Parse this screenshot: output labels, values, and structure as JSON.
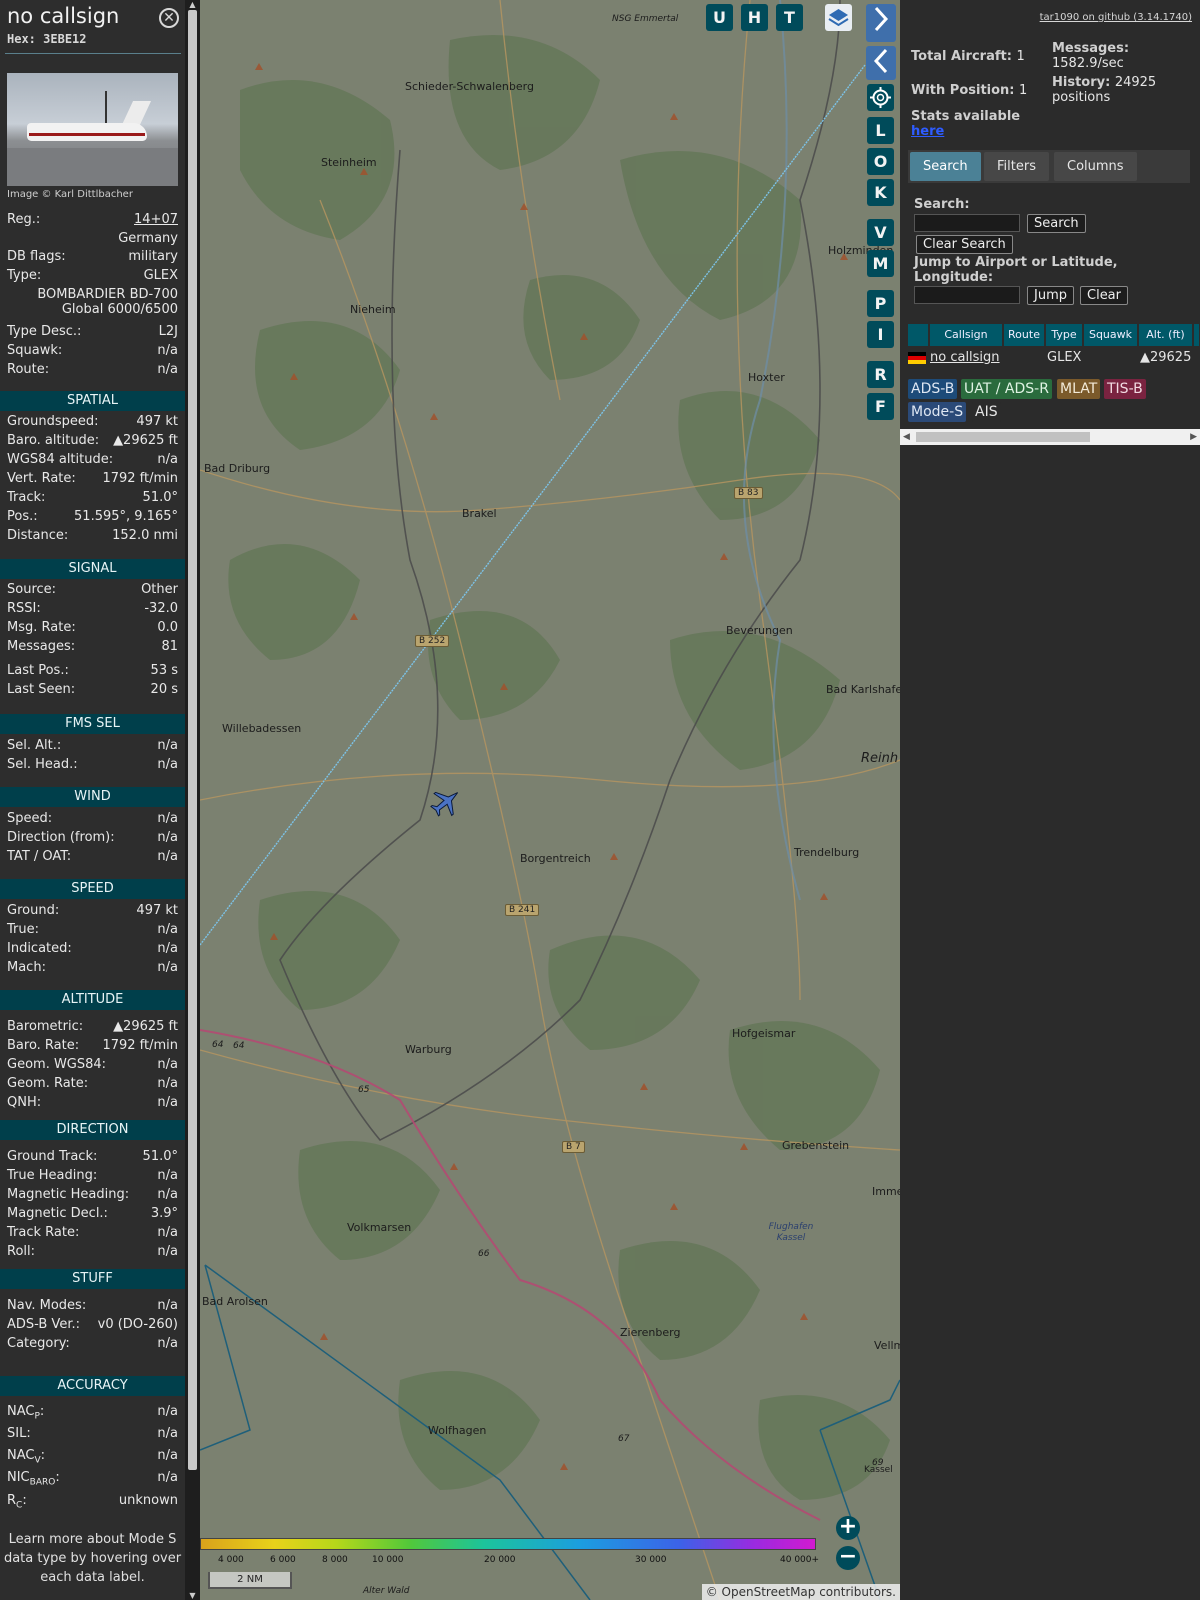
{
  "details": {
    "callsign": "no callsign",
    "hex_label": "Hex:",
    "hex": "3EBE12",
    "image_credit": "Image © Karl Dittlbacher",
    "reg_label": "Reg.:",
    "reg": "14+07",
    "country": "Germany",
    "dbflags_label": "DB flags:",
    "dbflags": "military",
    "type_label": "Type:",
    "type": "GLEX",
    "type_full": "BOMBARDIER BD-700 Global 6000/6500",
    "type_desc_label": "Type Desc.:",
    "type_desc": "L2J",
    "squawk_label": "Squawk:",
    "squawk": "n/a",
    "route_label": "Route:",
    "route": "n/a"
  },
  "spatial": {
    "title": "SPATIAL",
    "rows": [
      {
        "k": "Groundspeed:",
        "v": "497 kt"
      },
      {
        "k": "Baro. altitude:",
        "v": "▲29625 ft"
      },
      {
        "k": "WGS84 altitude:",
        "v": "n/a"
      },
      {
        "k": "Vert. Rate:",
        "v": "1792 ft/min"
      },
      {
        "k": "Track:",
        "v": "51.0°"
      },
      {
        "k": "Pos.:",
        "v": "51.595°, 9.165°"
      },
      {
        "k": "Distance:",
        "v": "152.0 nmi"
      }
    ]
  },
  "signal": {
    "title": "SIGNAL",
    "rows": [
      {
        "k": "Source:",
        "v": "Other"
      },
      {
        "k": "RSSI:",
        "v": "-32.0"
      },
      {
        "k": "Msg. Rate:",
        "v": "0.0"
      },
      {
        "k": "Messages:",
        "v": "81"
      },
      {
        "k": "Last Pos.:",
        "v": "53 s"
      },
      {
        "k": "Last Seen:",
        "v": "20 s"
      }
    ]
  },
  "fms": {
    "title": "FMS SEL",
    "rows": [
      {
        "k": "Sel. Alt.:",
        "v": "n/a"
      },
      {
        "k": "Sel. Head.:",
        "v": "n/a"
      }
    ]
  },
  "wind": {
    "title": "WIND",
    "rows": [
      {
        "k": "Speed:",
        "v": "n/a"
      },
      {
        "k": "Direction (from):",
        "v": "n/a"
      },
      {
        "k": "TAT / OAT:",
        "v": "n/a"
      }
    ]
  },
  "speed": {
    "title": "SPEED",
    "rows": [
      {
        "k": "Ground:",
        "v": "497 kt"
      },
      {
        "k": "True:",
        "v": "n/a"
      },
      {
        "k": "Indicated:",
        "v": "n/a"
      },
      {
        "k": "Mach:",
        "v": "n/a"
      }
    ]
  },
  "altitude": {
    "title": "ALTITUDE",
    "rows": [
      {
        "k": "Barometric:",
        "v": "▲29625 ft"
      },
      {
        "k": "Baro. Rate:",
        "v": "1792 ft/min"
      },
      {
        "k": "Geom. WGS84:",
        "v": "n/a"
      },
      {
        "k": "Geom. Rate:",
        "v": "n/a"
      },
      {
        "k": "QNH:",
        "v": "n/a"
      }
    ]
  },
  "direction": {
    "title": "DIRECTION",
    "rows": [
      {
        "k": "Ground Track:",
        "v": "51.0°"
      },
      {
        "k": "True Heading:",
        "v": "n/a"
      },
      {
        "k": "Magnetic Heading:",
        "v": "n/a"
      },
      {
        "k": "Magnetic Decl.:",
        "v": "3.9°"
      },
      {
        "k": "Track Rate:",
        "v": "n/a"
      },
      {
        "k": "Roll:",
        "v": "n/a"
      }
    ]
  },
  "stuff": {
    "title": "STUFF",
    "rows": [
      {
        "k": "Nav. Modes:",
        "v": "n/a"
      },
      {
        "k": "ADS-B Ver.:",
        "v": "v0 (DO-260)"
      },
      {
        "k": "Category:",
        "v": "n/a"
      }
    ]
  },
  "accuracy": {
    "title": "ACCURACY",
    "nacp_k": "NAC",
    "nacp_sub": "P",
    "nacp": "n/a",
    "sil_k": "SIL:",
    "sil": "n/a",
    "nacv_k": "NAC",
    "nacv_sub": "V",
    "nacv": "n/a",
    "nic_k": "NIC",
    "nic_sub": "BARO",
    "nic": "n/a",
    "rc_k": "R",
    "rc_sub": "C",
    "rc": "unknown"
  },
  "learn_more": "Learn more about Mode S data type by hovering over each data label.",
  "map": {
    "top_buttons": [
      "U",
      "H",
      "T"
    ],
    "side_buttons": [
      "L",
      "O",
      "K",
      "V",
      "M",
      "P",
      "I",
      "R",
      "F"
    ],
    "places": [
      "NSG Emmertal",
      "Schieder-Schwalenberg",
      "Steinheim",
      "Holzminden",
      "Nieheim",
      "Hoxter",
      "Bad Driburg",
      "Brakel",
      "Beverungen",
      "Bad Karlshafen",
      "Willebadessen",
      "Reinh",
      "Borgentreich",
      "Trendelburg",
      "Warburg",
      "Hofgeismar",
      "Grebenstein",
      "Imme",
      "Flughafen Kassel",
      "Volkmarsen",
      "Bad Arolsen",
      "Zierenberg",
      "Wolfhagen",
      "Vellm",
      "Kassel",
      "Alter Wald"
    ],
    "roads": [
      "B 83",
      "B 252",
      "B 241",
      "B 7"
    ],
    "road_numbers": [
      "64",
      "64",
      "65",
      "66",
      "67",
      "69"
    ],
    "altitude_scale": [
      "4 000",
      "6 000",
      "8 000",
      "10 000",
      "20 000",
      "30 000",
      "40 000+"
    ],
    "scale_label": "2 NM",
    "attribution": "© OpenStreetMap contributors."
  },
  "right": {
    "github": "tar1090 on github (3.14.1740)",
    "total_aircraft_label": "Total Aircraft:",
    "total_aircraft": "1",
    "with_position_label": "With Position:",
    "with_position": "1",
    "messages_label": "Messages:",
    "messages": "1582.9/sec",
    "history_label": "History:",
    "history": "24925 positions",
    "stats_label": "Stats available",
    "stats_link": "here",
    "tabs": [
      "Search",
      "Filters",
      "Columns"
    ],
    "search_label": "Search:",
    "search_btn": "Search",
    "clear_search_btn": "Clear Search",
    "jump_label": "Jump to Airport or Latitude, Longitude:",
    "jump_btn": "Jump",
    "clear_btn": "Clear",
    "columns": [
      "Callsign",
      "Route",
      "Type",
      "Squawk",
      "Alt. (ft)"
    ],
    "row": {
      "callsign": "no callsign",
      "type": "GLEX",
      "alt": "▲29625"
    },
    "badges": [
      {
        "label": "ADS-B",
        "bg": "#1d4b79"
      },
      {
        "label": "UAT / ADS-R",
        "bg": "#2a6b3d"
      },
      {
        "label": "MLAT",
        "bg": "#7b5a2b"
      },
      {
        "label": "TIS-B",
        "bg": "#7a2340"
      },
      {
        "label": "Mode-S",
        "bg": "#2b4a78"
      },
      {
        "label": "AIS",
        "bg": "#2b2b2b"
      }
    ]
  }
}
